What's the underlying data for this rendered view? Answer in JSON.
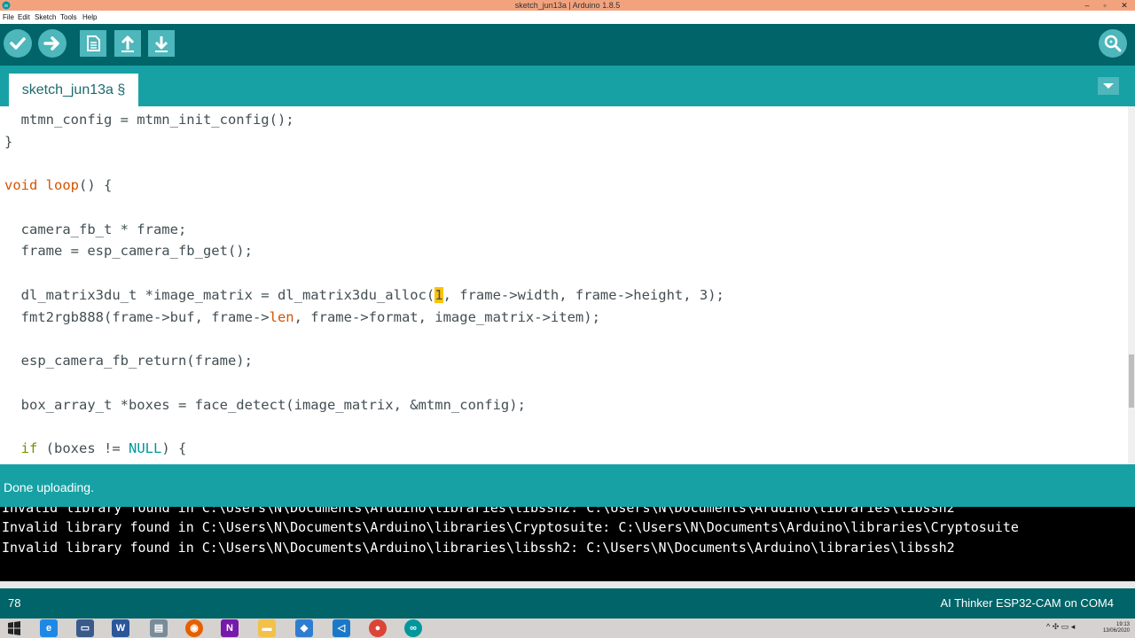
{
  "window": {
    "title": "sketch_jun13a | Arduino 1.8.5",
    "minimize": "–",
    "maximize": "▫",
    "close": "✕"
  },
  "menu": [
    "File",
    "Edit",
    "Sketch",
    "Tools",
    "Help"
  ],
  "toolbar": {
    "verify_icon": "check-icon",
    "upload_icon": "arrow-right-icon",
    "new_icon": "new-file-icon",
    "open_icon": "arrow-up-icon",
    "save_icon": "arrow-down-icon",
    "serial_monitor_icon": "magnifier-icon"
  },
  "tabs": [
    {
      "label": "sketch_jun13a §"
    }
  ],
  "editor": {
    "lines": [
      "  mtmn_config = mtmn_init_config();",
      "}",
      "",
      "void loop() {",
      "",
      "  camera_fb_t * frame;",
      "  frame = esp_camera_fb_get();",
      "",
      "  dl_matrix3du_t *image_matrix = dl_matrix3du_alloc(1, frame->width, frame->height, 3);",
      "  fmt2rgb888(frame->buf, frame->len, frame->format, image_matrix->item);",
      "",
      "  esp_camera_fb_return(frame);",
      "",
      "  box_array_t *boxes = face_detect(image_matrix, &mtmn_config);",
      "",
      "  if (boxes != NULL) {"
    ]
  },
  "status": {
    "message": "Done uploading."
  },
  "console": {
    "lines": [
      "Invalid library found in C:\\Users\\N\\Documents\\Arduino\\libraries\\libssh2: C:\\Users\\N\\Documents\\Arduino\\libraries\\libssh2",
      "Invalid library found in C:\\Users\\N\\Documents\\Arduino\\libraries\\Cryptosuite: C:\\Users\\N\\Documents\\Arduino\\libraries\\Cryptosuite",
      "Invalid library found in C:\\Users\\N\\Documents\\Arduino\\libraries\\libssh2: C:\\Users\\N\\Documents\\Arduino\\libraries\\libssh2"
    ]
  },
  "footer": {
    "line_number": "78",
    "board": "AI Thinker ESP32-CAM on COM4"
  },
  "taskbar": {
    "apps": [
      "windows-start-icon",
      "internet-explorer-icon",
      "app-icon",
      "word-icon",
      "file-icon",
      "firefox-icon",
      "onenote-icon",
      "file-explorer-icon",
      "sourcetree-icon",
      "visual-studio-code-icon",
      "chrome-icon",
      "arduino-icon"
    ],
    "time": "19:13",
    "date": "13/06/2020"
  },
  "colors": {
    "toolbar": "#006468",
    "tabbar": "#17a1a5",
    "keyword_teal": "#00979c",
    "keyword_brown": "#d35400",
    "keyword_green": "#728e00"
  }
}
